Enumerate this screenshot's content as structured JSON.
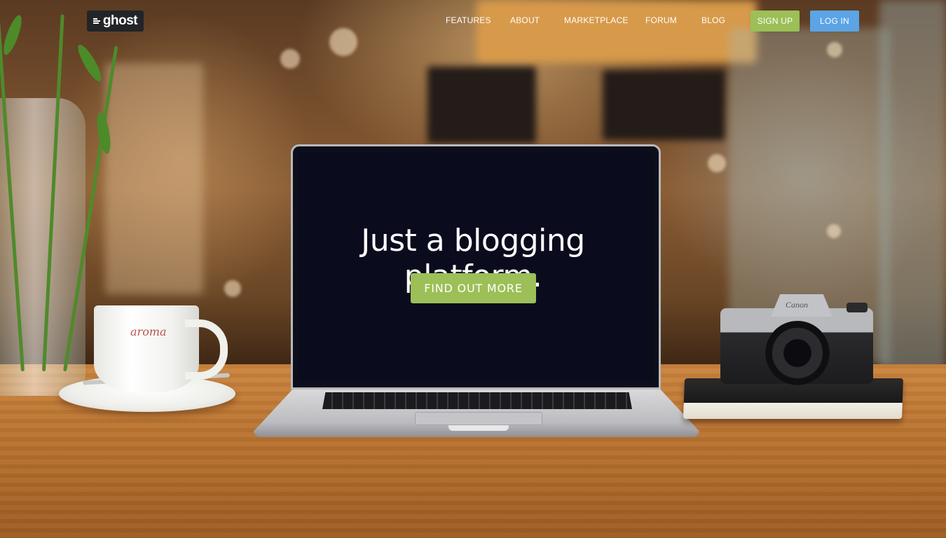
{
  "logo": {
    "text": "ghost"
  },
  "nav": {
    "links": [
      "FEATURES",
      "ABOUT",
      "MARKETPLACE",
      "FORUM",
      "BLOG"
    ],
    "signup_label": "SIGN UP",
    "login_label": "LOG IN"
  },
  "hero": {
    "title": "Just a blogging platform.",
    "button_label": "FIND OUT MORE"
  },
  "photo": {
    "cup_logo": "aroma",
    "camera_brand": "Canon"
  },
  "colors": {
    "green_button": "#9cbf57",
    "blue_button": "#5ba4e5",
    "logo_bg": "#222427",
    "screen": "#0b0b1e"
  }
}
